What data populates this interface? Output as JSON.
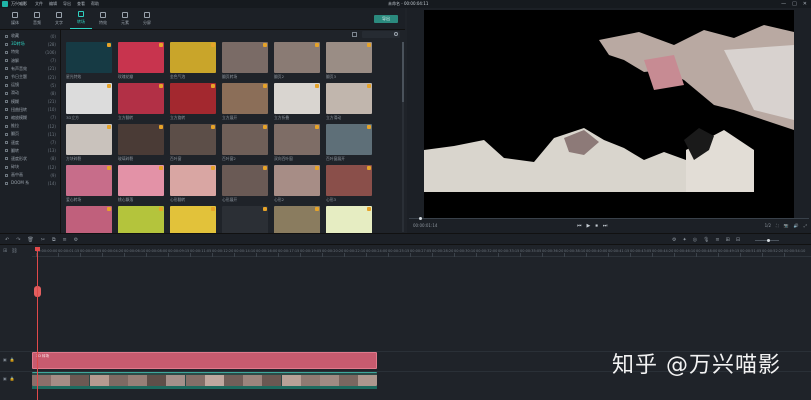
{
  "titlebar": {
    "app_name": "万兴喵影",
    "menu": [
      "文件",
      "编辑",
      "导出",
      "查看",
      "帮助"
    ],
    "project": "未命名 - 00:00:04:11",
    "controls": [
      "—",
      "□",
      "✕"
    ]
  },
  "toolbar": {
    "items": [
      {
        "label": "媒体",
        "active": false
      },
      {
        "label": "音频",
        "active": false
      },
      {
        "label": "文字",
        "active": false
      },
      {
        "label": "转场",
        "active": true
      },
      {
        "label": "特效",
        "active": false
      },
      {
        "label": "元素",
        "active": false
      },
      {
        "label": "分屏",
        "active": false
      }
    ],
    "export_label": "导出"
  },
  "sidebar": {
    "categories": [
      {
        "label": "收藏",
        "count": "(0)"
      },
      {
        "label": "3D转场",
        "count": "(28)",
        "active": true
      },
      {
        "label": "特效",
        "count": "(106)"
      },
      {
        "label": "溶解",
        "count": "(7)"
      },
      {
        "label": "有声音效",
        "count": "(21)"
      },
      {
        "label": "节日主题",
        "count": "(21)"
      },
      {
        "label": "运镜",
        "count": "(5)"
      },
      {
        "label": "滑动",
        "count": "(8)"
      },
      {
        "label": "模糊",
        "count": "(21)"
      },
      {
        "label": "扭曲扭转",
        "count": "(10)"
      },
      {
        "label": "缩放模糊",
        "count": "(7)"
      },
      {
        "label": "推拉",
        "count": "(12)"
      },
      {
        "label": "翻页",
        "count": "(11)"
      },
      {
        "label": "速度",
        "count": "(7)"
      },
      {
        "label": "翻转",
        "count": "(13)"
      },
      {
        "label": "速度形状",
        "count": "(8)"
      },
      {
        "label": "碎块",
        "count": "(12)"
      },
      {
        "label": "画中画",
        "count": "(9)"
      },
      {
        "label": "DOOM 系",
        "count": "(14)"
      }
    ]
  },
  "browser": {
    "search_value": "搜索",
    "thumbnails": [
      {
        "label": "星光特效",
        "color": "#163a44",
        "selected": false
      },
      {
        "label": "玫瑰花瓣",
        "color": "#c8344e",
        "selected": false
      },
      {
        "label": "金色气泡",
        "color": "#c9a52a",
        "selected": false
      },
      {
        "label": "翻页转场",
        "color": "#7a6b66",
        "selected": false
      },
      {
        "label": "翻页2",
        "color": "#8a7b74",
        "selected": false
      },
      {
        "label": "翻页3",
        "color": "#9a8d85",
        "selected": false
      },
      {
        "label": "3D立方",
        "color": "#dcdcdc",
        "selected": false
      },
      {
        "label": "立方翻转",
        "color": "#b23046",
        "selected": false
      },
      {
        "label": "立方旋转",
        "color": "#a3282f",
        "selected": false
      },
      {
        "label": "立方展开",
        "color": "#8b6e58",
        "selected": false
      },
      {
        "label": "立方折叠",
        "color": "#d9d5d0",
        "selected": false
      },
      {
        "label": "立方滑动",
        "color": "#c1b6ad",
        "selected": false
      },
      {
        "label": "方块碎裂",
        "color": "#c9c2bc",
        "selected": false
      },
      {
        "label": "玻璃碎裂",
        "color": "#4a3b36",
        "selected": false
      },
      {
        "label": "百叶窗",
        "color": "#5c4e48",
        "selected": false
      },
      {
        "label": "百叶窗2",
        "color": "#6f5f58",
        "selected": false
      },
      {
        "label": "双向百叶窗",
        "color": "#7e6d66",
        "selected": false
      },
      {
        "label": "百叶窗展开",
        "color": "#5e6f78",
        "selected": false
      },
      {
        "label": "爱心转场",
        "color": "#c76d8a",
        "selected": false
      },
      {
        "label": "桃心飘落",
        "color": "#e392a7",
        "selected": false
      },
      {
        "label": "心形翻转",
        "color": "#d9a6a3",
        "selected": false
      },
      {
        "label": "心形展开",
        "color": "#6a5a55",
        "selected": false
      },
      {
        "label": "心形2",
        "color": "#a78d86",
        "selected": false
      },
      {
        "label": "心形3",
        "color": "#8a4f4a",
        "selected": false
      },
      {
        "label": "",
        "color": "#c0607c",
        "selected": false
      },
      {
        "label": "",
        "color": "#b4c43c",
        "selected": false
      },
      {
        "label": "",
        "color": "#e2c23a",
        "selected": false
      },
      {
        "label": "",
        "color": "#2b2f35",
        "selected": false
      },
      {
        "label": "",
        "color": "#8a7c5f",
        "selected": false
      },
      {
        "label": "",
        "color": "#e6edc2",
        "selected": false
      }
    ]
  },
  "preview": {
    "timecode": "00:00:01:14",
    "controls": [
      "⏮",
      "▶",
      "⏹",
      "⏭"
    ],
    "quality": "1/2",
    "right_controls": [
      "⛶",
      "📷",
      "🔊",
      "⤢"
    ]
  },
  "timeline": {
    "tools": [
      "↶",
      "↷",
      "🗑",
      "✂",
      "⧉",
      "≡",
      "⚙"
    ],
    "right_tools": [
      "⚙",
      "✦",
      "◎",
      "🎙",
      "≡",
      "⊞",
      "⊟"
    ],
    "ruler": [
      "00:00:00:00",
      "00:00:01:15",
      "00:00:03:05",
      "00:00:04:20",
      "00:00:06:10",
      "00:00:08:00",
      "00:00:09:15",
      "00:00:11:05",
      "00:00:12:20",
      "00:00:14:10",
      "00:00:16:00",
      "00:00:17:15",
      "00:00:19:05",
      "00:00:20:20",
      "00:00:22:10",
      "00:00:24:00",
      "00:00:25:15",
      "00:00:27:05",
      "00:00:28:20",
      "00:00:30:10",
      "00:00:32:00",
      "00:00:33:15",
      "00:00:35:05",
      "00:00:36:20",
      "00:00:38:10",
      "00:00:40:00",
      "00:00:41:15",
      "00:00:43:05",
      "00:00:44:20",
      "00:00:46:10",
      "00:00:48:00",
      "00:00:49:15",
      "00:00:51:05",
      "00:00:52:20",
      "00:00:54:10"
    ],
    "fx_clip_label": "3D 转场",
    "watermark": "知乎 @万兴喵影"
  }
}
